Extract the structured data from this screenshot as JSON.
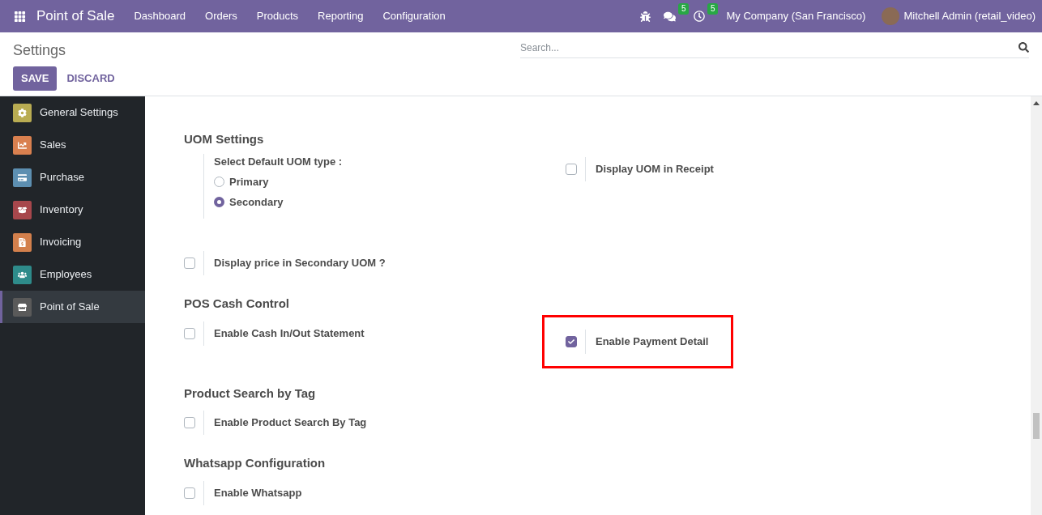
{
  "navbar": {
    "app_title": "Point of Sale",
    "menu": [
      "Dashboard",
      "Orders",
      "Products",
      "Reporting",
      "Configuration"
    ],
    "messages_badge": "5",
    "activities_badge": "5",
    "company": "My Company (San Francisco)",
    "user": "Mitchell Admin (retail_video)"
  },
  "control_panel": {
    "title": "Settings",
    "search": {
      "placeholder": "Search..."
    },
    "save": "SAVE",
    "discard": "DISCARD"
  },
  "sidebar": {
    "items": [
      {
        "label": "General Settings",
        "color": "#b9ac52",
        "selected": false
      },
      {
        "label": "Sales",
        "color": "#d9804f",
        "selected": false
      },
      {
        "label": "Purchase",
        "color": "#5d8fb1",
        "selected": false
      },
      {
        "label": "Inventory",
        "color": "#a7474c",
        "selected": false
      },
      {
        "label": "Invoicing",
        "color": "#d3804c",
        "selected": false
      },
      {
        "label": "Employees",
        "color": "#2e8b8a",
        "selected": false
      },
      {
        "label": "Point of Sale",
        "color": "#5a5a5a",
        "selected": true
      }
    ]
  },
  "sections": [
    {
      "title": "UOM Settings",
      "settings": [
        {
          "kind": "radio",
          "label": "Select Default UOM type :",
          "options": [
            {
              "label": "Primary",
              "selected": false
            },
            {
              "label": "Secondary",
              "selected": true
            }
          ]
        },
        {
          "kind": "checkbox",
          "label": "Display UOM in Receipt",
          "checked": false,
          "highlighted": false
        },
        {
          "kind": "checkbox",
          "label": "Display price in Secondary UOM ?",
          "checked": false,
          "highlighted": false
        }
      ]
    },
    {
      "title": "POS Cash Control",
      "settings": [
        {
          "kind": "checkbox",
          "label": "Enable Cash In/Out Statement",
          "checked": false,
          "highlighted": false
        },
        {
          "kind": "checkbox",
          "label": "Enable Payment Detail",
          "checked": true,
          "highlighted": true
        }
      ]
    },
    {
      "title": "Product Search by Tag",
      "settings": [
        {
          "kind": "checkbox",
          "label": "Enable Product Search By Tag",
          "checked": false,
          "highlighted": false
        }
      ]
    },
    {
      "title": "Whatsapp Configuration",
      "settings": [
        {
          "kind": "checkbox",
          "label": "Enable Whatsapp",
          "checked": false,
          "highlighted": false
        }
      ]
    }
  ]
}
